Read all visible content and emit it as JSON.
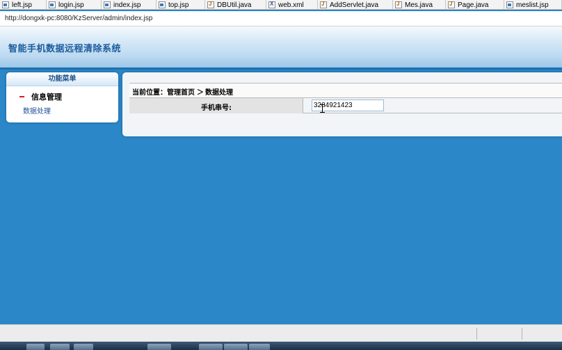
{
  "editor_tabs": [
    {
      "label": "left.jsp",
      "icon": "jsp-file-icon",
      "type": "jsp"
    },
    {
      "label": "login.jsp",
      "icon": "jsp-file-icon",
      "type": "jsp"
    },
    {
      "label": "index.jsp",
      "icon": "jsp-file-icon",
      "type": "jsp"
    },
    {
      "label": "top.jsp",
      "icon": "jsp-file-icon",
      "type": "jsp"
    },
    {
      "label": "DBUtil.java",
      "icon": "java-file-icon",
      "type": "java"
    },
    {
      "label": "web.xml",
      "icon": "xml-file-icon",
      "type": "xml"
    },
    {
      "label": "AddServlet.java",
      "icon": "java-file-icon",
      "type": "java"
    },
    {
      "label": "Mes.java",
      "icon": "java-file-icon",
      "type": "java"
    },
    {
      "label": "Page.java",
      "icon": "java-file-icon",
      "type": "java"
    },
    {
      "label": "meslist.jsp",
      "icon": "jsp-file-icon",
      "type": "jsp"
    }
  ],
  "address_bar": {
    "url": "http://dongxk-pc:8080/KzServer/admin/index.jsp"
  },
  "header": {
    "title": "智能手机数据远程清除系统"
  },
  "menu": {
    "heading": "功能菜单",
    "group_label": "信息管理",
    "items": [
      {
        "label": "数据处理"
      }
    ]
  },
  "breadcrumb": {
    "prefix": "当前位置：管理首页",
    "separator": "＞",
    "current": "数据处理"
  },
  "form": {
    "phone_serial_label": "手机串号:",
    "phone_serial_value": "3284921423"
  },
  "colors": {
    "page_blue": "#2b87c7",
    "banner_title": "#1c5b9c",
    "menu_link": "#1e4f99",
    "menu_marker": "#d02020"
  }
}
